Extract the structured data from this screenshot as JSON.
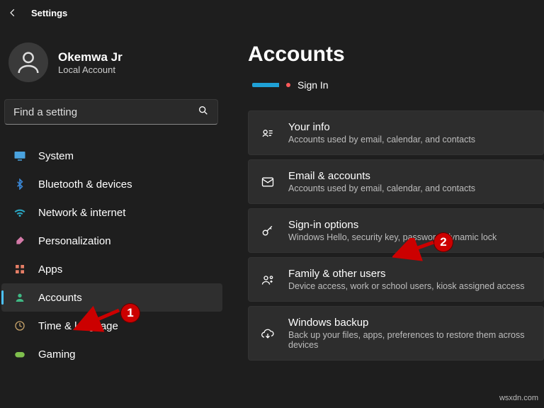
{
  "titlebar": {
    "app_name": "Settings"
  },
  "user": {
    "name": "Okemwa Jr",
    "account_type": "Local Account"
  },
  "search": {
    "placeholder": "Find a setting"
  },
  "sidebar": {
    "items": [
      {
        "label": "System",
        "icon": "monitor",
        "color": "#4aa3df"
      },
      {
        "label": "Bluetooth & devices",
        "icon": "bluetooth",
        "color": "#3a87d6"
      },
      {
        "label": "Network & internet",
        "icon": "wifi",
        "color": "#2aa5c1"
      },
      {
        "label": "Personalization",
        "icon": "brush",
        "color": "#d47aa8"
      },
      {
        "label": "Apps",
        "icon": "grid",
        "color": "#e67e66"
      },
      {
        "label": "Accounts",
        "icon": "person",
        "color": "#3fb984",
        "selected": true
      },
      {
        "label": "Time & language",
        "icon": "clock-globe",
        "color": "#c7a36b"
      },
      {
        "label": "Gaming",
        "icon": "gamepad",
        "color": "#7fbf4d"
      }
    ]
  },
  "page": {
    "title": "Accounts",
    "signin_label": "Sign In",
    "cards": [
      {
        "icon": "id-card",
        "title": "Your info",
        "subtitle": "Accounts used by email, calendar, and contacts"
      },
      {
        "icon": "mail",
        "title": "Email & accounts",
        "subtitle": "Accounts used by email, calendar, and contacts"
      },
      {
        "icon": "key",
        "title": "Sign-in options",
        "subtitle": "Windows Hello, security key, password, dynamic lock"
      },
      {
        "icon": "people-plus",
        "title": "Family & other users",
        "subtitle": "Device access, work or school users, kiosk assigned access"
      },
      {
        "icon": "cloud-backup",
        "title": "Windows backup",
        "subtitle": "Back up your files, apps, preferences to restore them across devices"
      }
    ]
  },
  "annotations": {
    "badge1": "1",
    "badge2": "2"
  },
  "watermark": "wsxdn.com"
}
